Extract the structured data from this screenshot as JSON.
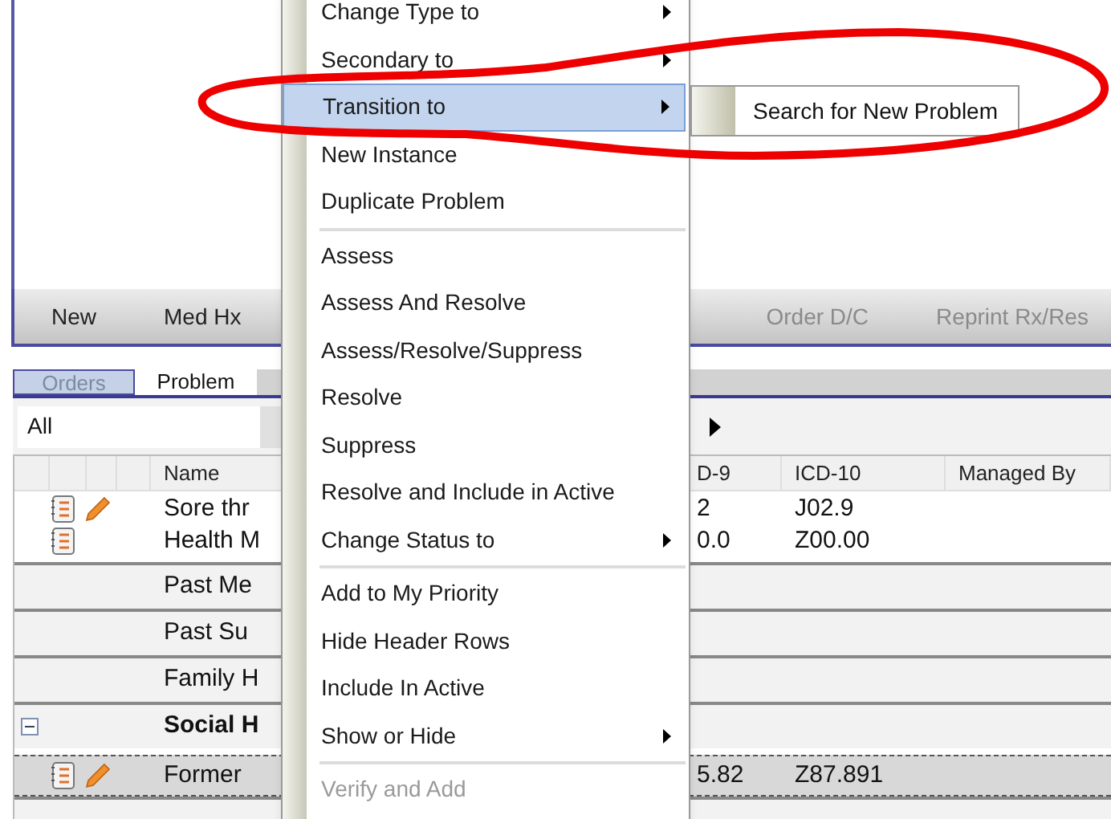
{
  "toolbar": {
    "buttons": [
      {
        "label": "New",
        "disabled": false
      },
      {
        "label": "Med Hx",
        "disabled": false
      },
      {
        "label": "Order D/C",
        "disabled": true
      },
      {
        "label": "Reprint Rx/Res",
        "disabled": true
      }
    ]
  },
  "tabs": [
    {
      "label": "Orders",
      "selected": false
    },
    {
      "label": "Problem",
      "selected": true
    }
  ],
  "filter": {
    "value": "All"
  },
  "grid": {
    "columns": [
      "Name",
      "D-9",
      "ICD-10",
      "Managed By"
    ],
    "rows": [
      {
        "kind": "item",
        "name": "Sore thr",
        "icd9": "2",
        "icd10": "J02.9",
        "editable": true,
        "selected": false
      },
      {
        "kind": "item",
        "name": "Health M",
        "icd9": "0.0",
        "icd10": "Z00.00",
        "editable": false,
        "selected": false
      },
      {
        "kind": "group",
        "name": "Past Me"
      },
      {
        "kind": "group",
        "name": "Past Su"
      },
      {
        "kind": "group",
        "name": "Family H"
      },
      {
        "kind": "header",
        "name": "Social H",
        "expanded": true
      },
      {
        "kind": "item",
        "name": "Former",
        "icd9": "5.82",
        "icd10": "Z87.891",
        "editable": true,
        "selected": true
      }
    ]
  },
  "context_menu": {
    "items": [
      {
        "kind": "item",
        "label": "Change Type to",
        "submenu": true,
        "disabled": false,
        "selected": false
      },
      {
        "kind": "item",
        "label": "Secondary to",
        "submenu": true,
        "disabled": false,
        "selected": false
      },
      {
        "kind": "item",
        "label": "Transition to",
        "submenu": true,
        "disabled": false,
        "selected": true
      },
      {
        "kind": "item",
        "label": "New Instance",
        "submenu": false,
        "disabled": false,
        "selected": false
      },
      {
        "kind": "item",
        "label": "Duplicate Problem",
        "submenu": false,
        "disabled": false,
        "selected": false
      },
      {
        "kind": "separator"
      },
      {
        "kind": "item",
        "label": "Assess",
        "submenu": false,
        "disabled": false,
        "selected": false
      },
      {
        "kind": "item",
        "label": "Assess And Resolve",
        "submenu": false,
        "disabled": false,
        "selected": false
      },
      {
        "kind": "item",
        "label": "Assess/Resolve/Suppress",
        "submenu": false,
        "disabled": false,
        "selected": false
      },
      {
        "kind": "item",
        "label": "Resolve",
        "submenu": false,
        "disabled": false,
        "selected": false
      },
      {
        "kind": "item",
        "label": "Suppress",
        "submenu": false,
        "disabled": false,
        "selected": false
      },
      {
        "kind": "item",
        "label": "Resolve and Include in Active",
        "submenu": false,
        "disabled": false,
        "selected": false
      },
      {
        "kind": "item",
        "label": "Change Status to",
        "submenu": true,
        "disabled": false,
        "selected": false
      },
      {
        "kind": "separator"
      },
      {
        "kind": "item",
        "label": "Add to My Priority",
        "submenu": false,
        "disabled": false,
        "selected": false
      },
      {
        "kind": "item",
        "label": "Hide Header Rows",
        "submenu": false,
        "disabled": false,
        "selected": false
      },
      {
        "kind": "item",
        "label": "Include In Active",
        "submenu": false,
        "disabled": false,
        "selected": false
      },
      {
        "kind": "item",
        "label": "Show or Hide",
        "submenu": true,
        "disabled": false,
        "selected": false
      },
      {
        "kind": "separator"
      },
      {
        "kind": "item",
        "label": "Verify and Add",
        "submenu": false,
        "disabled": true,
        "selected": false
      }
    ]
  },
  "submenu": {
    "items": [
      {
        "label": "Search for New Problem"
      }
    ]
  }
}
